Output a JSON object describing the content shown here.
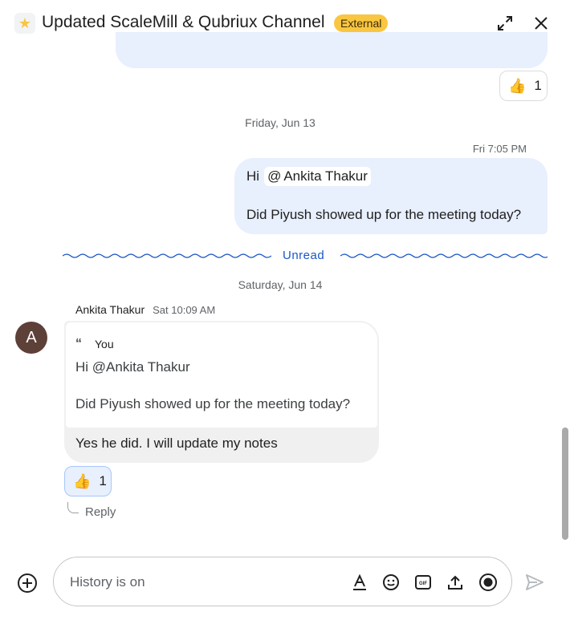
{
  "header": {
    "title": "Updated ScaleMill & Qubriux Channel",
    "badge": "External",
    "space_icon": "star-icon",
    "actions": [
      "expand-icon",
      "close-icon"
    ]
  },
  "messages": {
    "previous_reaction": {
      "emoji": "👍",
      "count": "1"
    },
    "date_1": "Friday, Jun 13",
    "outgoing": {
      "time": "Fri 7:05 PM",
      "greeting": "Hi",
      "mention": "Ankita Thakur",
      "mention_symbol": "@",
      "body": "Did Piyush showed up for the meeting today?"
    },
    "unread_label": "Unread",
    "date_2": "Saturday, Jun 14",
    "incoming": {
      "avatar_letter": "A",
      "sender": "Ankita Thakur",
      "time": "Sat 10:09 AM",
      "quote_author": "You",
      "quote_line1": "Hi @Ankita Thakur",
      "quote_line2": "Did Piyush showed up for the meeting today?",
      "reply": "Yes he did. I will update my notes",
      "reaction": {
        "emoji": "👍",
        "count": "1"
      },
      "reply_label": "Reply"
    }
  },
  "composer": {
    "placeholder": "History is on",
    "tools": [
      "format-text-icon",
      "emoji-icon",
      "gif-icon",
      "upload-icon",
      "record-video-icon"
    ],
    "send_icon": "send-icon",
    "add_icon": "add-circle-icon"
  },
  "colors": {
    "badge": "#f9c642",
    "bubble_outgoing": "#e8effd",
    "bubble_incoming": "#f0f0f0",
    "unread": "#1a56c7",
    "avatar": "#5d4037"
  }
}
